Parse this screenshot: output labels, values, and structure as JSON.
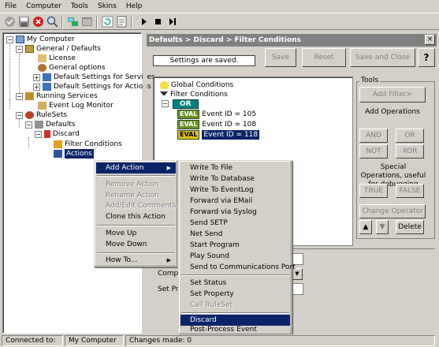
{
  "menubar": {
    "items": [
      "File",
      "Computer",
      "Tools",
      "Skins",
      "Help"
    ]
  },
  "tree": {
    "root": "My Computer",
    "general": "General / Defaults",
    "license": "License",
    "general_options": "General options",
    "default_services": "Default Settings for Services",
    "default_actions": "Default Settings for Actions",
    "running_services": "Running Services",
    "event_log_monitor": "Event Log Monitor",
    "rulesets": "RuleSets",
    "defaults": "Defaults",
    "discard": "Discard",
    "filter_conditions": "Filter Conditions",
    "actions": "Actions"
  },
  "panel": {
    "breadcrumb": "Defaults > Discard > Filter Conditions",
    "saved_status": "Settings are saved.",
    "save": "Save",
    "reset": "Reset",
    "save_close": "Save and Close",
    "help": "?"
  },
  "conditions": {
    "global": "Global Conditions",
    "filter": "Filter Conditions",
    "or_label": "OR",
    "eval_label": "EVAL",
    "items": [
      "Event ID = 105",
      "Event ID = 108",
      "Event ID = 118"
    ]
  },
  "tools": {
    "title": "Tools",
    "add_filter": "Add Filter>",
    "add_operations": "Add Operations",
    "and": "AND",
    "or": "OR",
    "not": "NOT",
    "xor": "XOR",
    "special_ops": "Special Operations, useful for debugging",
    "true_btn": "TRUE",
    "false_btn": "FALSE",
    "change_operator": "Change Operator",
    "delete": "Delete"
  },
  "props": {
    "compare_label": "Compa",
    "setprop_label": "Set Pr"
  },
  "context_menu": {
    "add_action": "Add Action",
    "remove_action": "Remove Action",
    "rename_action": "Rename Action",
    "add_edit_comments": "Add/Edit Comments",
    "clone_action": "Clone this Action",
    "move_up": "Move Up",
    "move_down": "Move Down",
    "how_to": "How To..."
  },
  "submenu": {
    "items": [
      "Write To File",
      "Write To Database",
      "Write To EventLog",
      "Forward via EMail",
      "Forward via Syslog",
      "Send SETP",
      "Net Send",
      "Start Program",
      "Play Sound",
      "Send to Communications Port",
      "Set Status",
      "Set Property",
      "Call RuleSet",
      "Discard",
      "Post-Process Event"
    ]
  },
  "status": {
    "connected_label": "Connected to:",
    "connected_value": "My Computer",
    "changes": "Changes made: 0"
  },
  "colors": {
    "selection": "#0a246a",
    "header_gray": "#808080",
    "eval_green": "#6b8e23",
    "or_teal": "#008080"
  }
}
